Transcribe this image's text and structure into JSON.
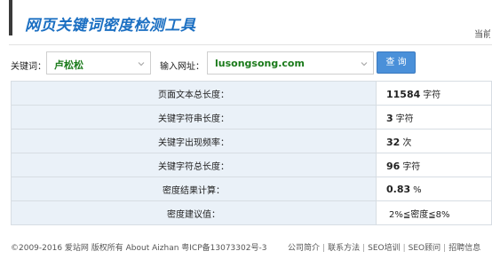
{
  "header": {
    "title": "网页关键词密度检测工具",
    "corner_text": "当前"
  },
  "form": {
    "keyword_label": "关键词：",
    "keyword_value": "卢松松",
    "url_label": "输入网址：",
    "url_value": "lusongsong.com",
    "query_button": "查 询"
  },
  "results": [
    {
      "label": "页面文本总长度：",
      "value": "11584",
      "unit": "字符"
    },
    {
      "label": "关键字符串长度：",
      "value": "3",
      "unit": "字符"
    },
    {
      "label": "关键字出现频率：",
      "value": "32",
      "unit": "次"
    },
    {
      "label": "关键字符总长度：",
      "value": "96",
      "unit": "字符"
    },
    {
      "label": "密度结果计算：",
      "value": "0.83",
      "unit": "%"
    },
    {
      "label": "密度建议值：",
      "value": "",
      "unit": "2%≦密度≦8%"
    }
  ],
  "footer": {
    "copyright": "©2009-2016 爱站网 版权所有 About Aizhan   粤ICP备13073302号-3",
    "links": [
      "公司简介",
      "联系方法",
      "SEO培训",
      "SEO顾问",
      "招聘信息"
    ]
  },
  "colors": {
    "title": "#1b6fc2",
    "button": "#4a90d9",
    "label_cell": "#eaf1f8",
    "keyword_text": "#1a7a1a"
  }
}
